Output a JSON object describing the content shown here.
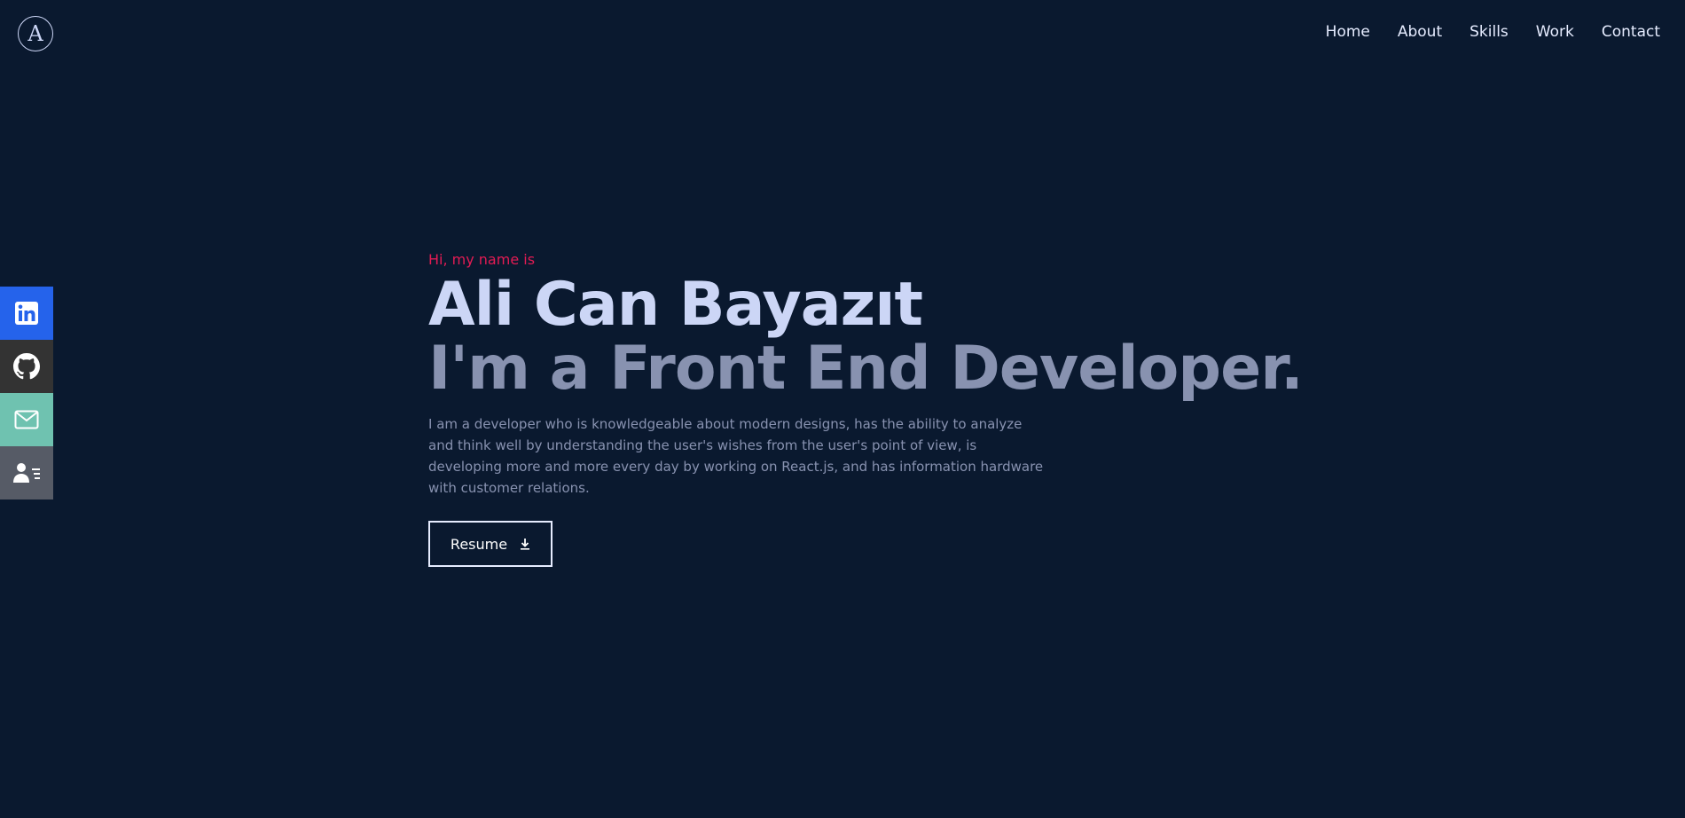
{
  "logo": {
    "letter": "A"
  },
  "nav": {
    "items": [
      {
        "label": "Home"
      },
      {
        "label": "About"
      },
      {
        "label": "Skills"
      },
      {
        "label": "Work"
      },
      {
        "label": "Contact"
      }
    ]
  },
  "social": {
    "items": [
      {
        "icon": "linkedin-icon",
        "color": "#2563eb"
      },
      {
        "icon": "github-icon",
        "color": "#333333"
      },
      {
        "icon": "mail-icon",
        "color": "#6fc2b0"
      },
      {
        "icon": "contact-card-icon",
        "color": "#565b66"
      }
    ]
  },
  "hero": {
    "greeting": "Hi, my name is",
    "name": "Ali Can Bayazıt",
    "role": "I'm a Front End Developer.",
    "description": "I am a developer who is knowledgeable about modern designs, has the ability to analyze and think well by understanding the user's wishes from the user's point of view, is developing more and more every day by working on React.js, and has information hardware with customer relations.",
    "resume_label": "Resume"
  },
  "colors": {
    "background": "#0a192f",
    "accent": "#e31b54",
    "heading": "#ccd6f6",
    "muted": "#8892b0"
  }
}
